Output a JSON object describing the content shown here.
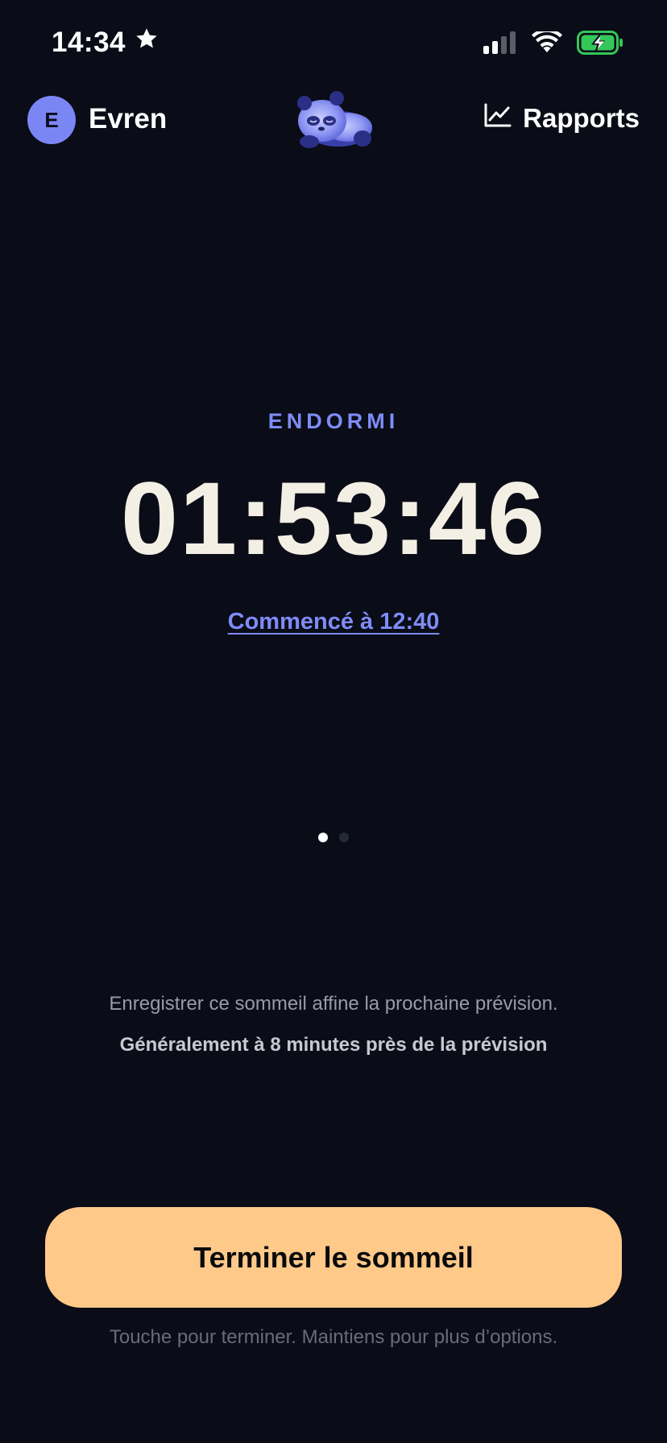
{
  "status_bar": {
    "time": "14:34",
    "time_icon": "star-icon",
    "icons": [
      "cellular-signal-icon",
      "wifi-icon",
      "battery-charging-icon"
    ],
    "battery_color": "#34c759"
  },
  "header": {
    "avatar_initial": "E",
    "user_name": "Evren",
    "mascot_icon": "sleeping-panda-icon",
    "reports_icon": "line-chart-icon",
    "reports_label": "Rapports"
  },
  "main": {
    "state_label": "ENDORMI",
    "timer": "01:53:46",
    "started_label": "Commencé à 12:40",
    "page_dots": {
      "count": 2,
      "active_index": 0
    }
  },
  "info": {
    "line1": "Enregistrer ce sommeil affine la prochaine prévision.",
    "line2": "Généralement à 8 minutes près de la prévision"
  },
  "action": {
    "end_button_label": "Terminer le sommeil",
    "hint": "Touche pour terminer. Maintiens pour plus d’options."
  },
  "colors": {
    "background": "#0a0c17",
    "accent": "#7f8cf6",
    "primary_button": "#ffc98a",
    "timer_text": "#f4efe4"
  }
}
